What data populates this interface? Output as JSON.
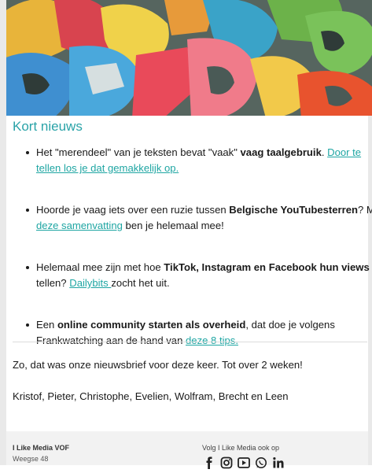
{
  "section": {
    "title": "Kort nieuws"
  },
  "news": [
    {
      "pre": "Het \"merendeel\" van je teksten bevat \"vaak\" ",
      "bold": "vaag taalgebruik",
      "mid": ". ",
      "link": "Door te tellen los je dat gemakkelijk op.",
      "post": ""
    },
    {
      "pre": "Hoorde je vaag iets over een ruzie tussen ",
      "bold": "Belgische YouTubesterren",
      "mid": "? Met ",
      "link": "deze samenvatting",
      "post": " ben je helemaal mee!"
    },
    {
      "pre": "Helemaal mee zijn met hoe ",
      "bold": "TikTok, Instagram en Facebook hun views",
      "mid": " tellen? ",
      "link": "Dailybits ",
      "post": "zocht het uit."
    },
    {
      "pre": "Een ",
      "bold": "online community starten als overheid",
      "mid": ", dat doe je volgens Frankwatching aan de hand van ",
      "link": "deze 8 tips.",
      "post": ""
    }
  ],
  "closing": "Zo, dat was onze nieuwsbrief voor deze keer. Tot over 2 weken!",
  "signoff": "Kristof, Pieter, Christophe, Evelien, Wolfram, Brecht en Leen",
  "footer": {
    "company": "I Like Media VOF",
    "street": "Weegse 48",
    "follow": "Volg I Like Media ook op",
    "social_icons": [
      "facebook-icon",
      "instagram-icon",
      "youtube-icon",
      "whatsapp-icon",
      "linkedin-icon"
    ]
  },
  "colors": {
    "accent": "#2aa3a8",
    "link": "#1fa6a3"
  }
}
